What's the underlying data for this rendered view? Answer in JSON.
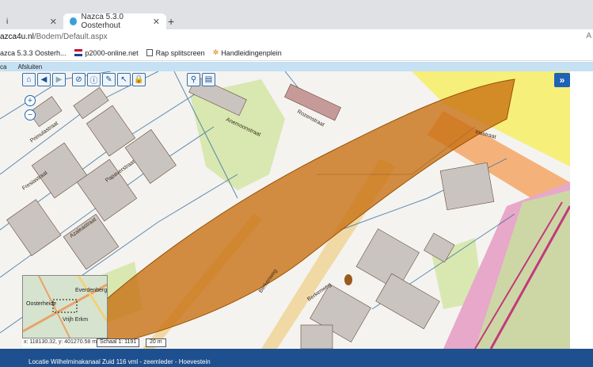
{
  "browser": {
    "tabs": [
      {
        "label": "i",
        "active": false
      },
      {
        "label": "Nazca 5.3.0 Oosterhout",
        "active": true
      }
    ],
    "new_tab_icon": "plus-icon",
    "url_host": "azca4u.nl",
    "url_path": "/Bodem/Default.aspx",
    "reader_label": "A",
    "bookmarks": [
      {
        "label": "azca 5.3.3 Oosterh...",
        "icon": "page-icon"
      },
      {
        "label": "p2000-online.net",
        "icon": "flag-icon"
      },
      {
        "label": "Rap splitscreen",
        "icon": "document-icon"
      },
      {
        "label": "Handleidingenplein",
        "icon": "star-icon"
      }
    ]
  },
  "app": {
    "menu": [
      "ca",
      "Afsluiten"
    ],
    "collapse_label": "»",
    "zoom_in": "+",
    "zoom_out": "−",
    "street_labels": [
      "Anemoonstraat",
      "Rozenstraat",
      "Papaverstraat",
      "Azaleastraat",
      "Primulastraat",
      "Berkenweg",
      "Berkenweg",
      "Irisstraat",
      "Fresiastraat"
    ],
    "overview": {
      "labels": [
        "Oosterheide",
        "Everdenberg",
        "Vrijh Erkm"
      ]
    },
    "coordinates": "x: 118130.32, y: 401270.58 m",
    "scale": "Schaal 1: 1191",
    "scalebar_label": "20 m",
    "status": "Locatie Wilhelminakanaal Zuid 116 vml - zeemleder - Hoevestein"
  },
  "colors": {
    "plume": "#c86e0f",
    "status_bar": "#1e4f8f",
    "accent_blue": "#1e63b5"
  }
}
